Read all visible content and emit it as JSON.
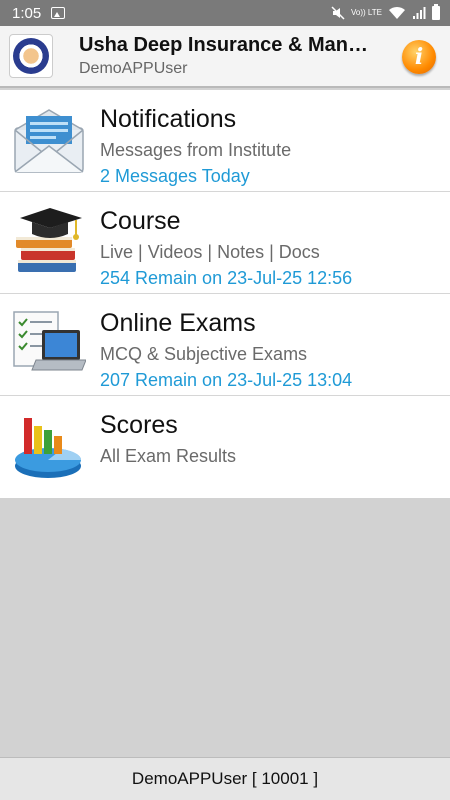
{
  "status_bar": {
    "time": "1:05",
    "volte": "Vo)) LTE"
  },
  "app_bar": {
    "title": "Usha Deep Insurance & Man…",
    "subtitle": "DemoAPPUser",
    "info_icon_glyph": "i"
  },
  "menu": [
    {
      "icon": "envelope-icon",
      "title": "Notifications",
      "subtitle": "Messages from Institute",
      "meta": "2 Messages Today"
    },
    {
      "icon": "graduation-books-icon",
      "title": "Course",
      "subtitle": "Live | Videos | Notes | Docs",
      "meta": "254 Remain on 23-Jul-25 12:56"
    },
    {
      "icon": "laptop-checklist-icon",
      "title": "Online Exams",
      "subtitle": "MCQ & Subjective Exams",
      "meta": "207 Remain on 23-Jul-25 13:04"
    },
    {
      "icon": "chart-icon",
      "title": "Scores",
      "subtitle": "All Exam Results"
    }
  ],
  "footer": {
    "user_label": "DemoAPPUser [ 10001 ]"
  },
  "colors": {
    "accent_meta": "#1f9ad6",
    "status_bar_bg": "#7a7a7a",
    "content_bg": "#d2d2d2"
  }
}
